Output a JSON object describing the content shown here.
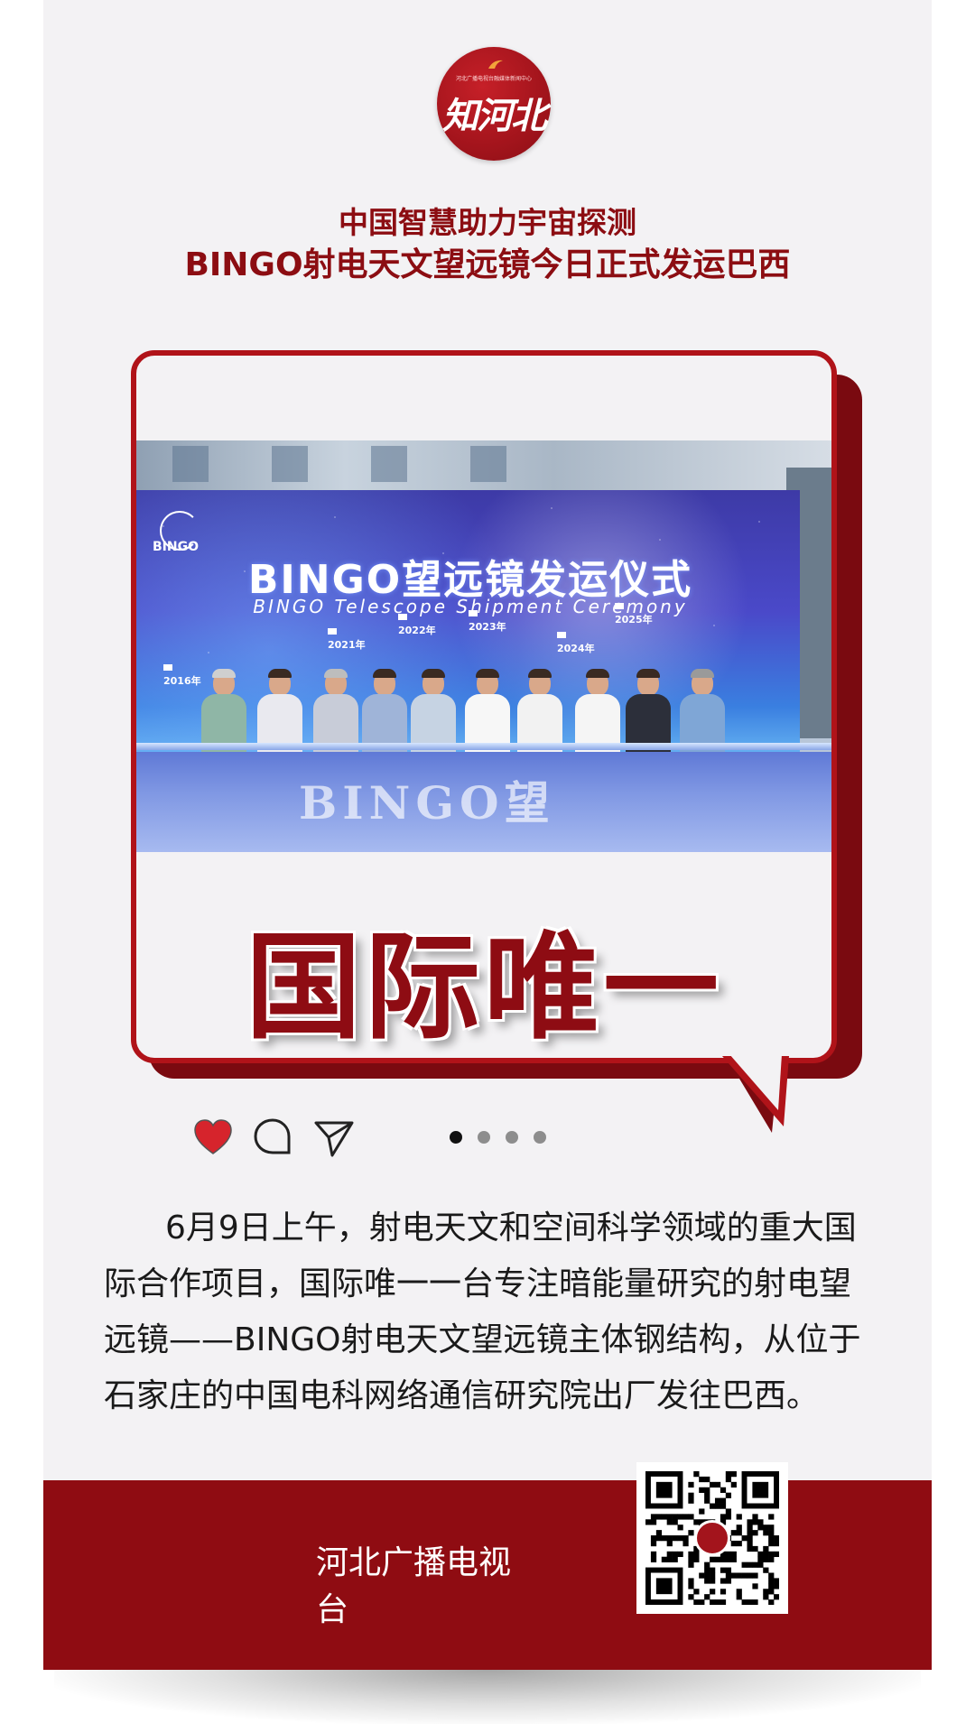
{
  "header": {
    "logo": {
      "tagline": "河北广播电视台融媒体新闻中心",
      "text": "知河北",
      "color": "#a3141c"
    },
    "title_line1": "中国智慧助力宇宙探测",
    "title_line2": "BINGO射电天文望远镜今日正式发运巴西"
  },
  "photo": {
    "banner_title_cn": "BINGO望远镜发运仪式",
    "banner_title_en": "BINGO Telescope Shipment Ceremony",
    "banner_logo": "BINGO",
    "timeline_years": [
      "2016年",
      "2021年",
      "2022年",
      "2023年",
      "2024年",
      "2025年"
    ],
    "stage_text": "BINGO望"
  },
  "highlight": {
    "text": "国际唯一",
    "color": "#8e0c13"
  },
  "actions": {
    "like_icon": "heart-icon",
    "comment_icon": "comment-icon",
    "share_icon": "send-icon",
    "carousel": {
      "total": 4,
      "active": 1
    }
  },
  "article": {
    "paragraph": "6月9日上午，射电天文和空间科学领域的重大国际合作项目，国际唯一一台专注暗能量研究的射电望远镜——BINGO射电天文望远镜主体钢结构，从位于石家庄的中国电科网络通信研究院出厂发往巴西。"
  },
  "footer": {
    "name": "河北广播电视台",
    "qr_icon": "qr-code-icon",
    "color": "#8f0c12"
  }
}
